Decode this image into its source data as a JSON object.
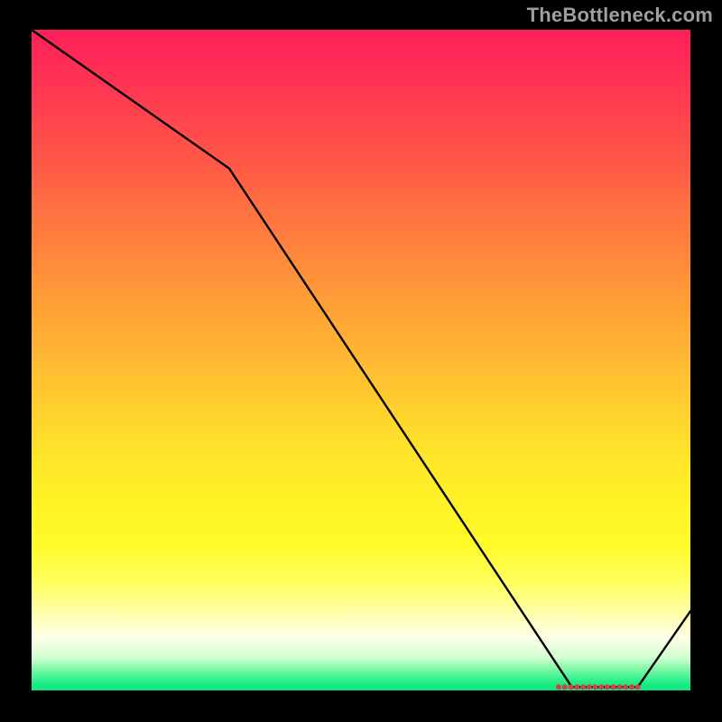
{
  "attribution": "TheBottleneck.com",
  "chart_data": {
    "type": "line",
    "title": "",
    "xlabel": "",
    "ylabel": "",
    "xlim": [
      0,
      100
    ],
    "ylim": [
      0,
      100
    ],
    "grid": false,
    "x": [
      0,
      30,
      82,
      92,
      100
    ],
    "values": [
      100,
      79,
      0.5,
      0.5,
      12
    ],
    "markers": {
      "x_range": [
        80,
        92
      ],
      "y": 0.5,
      "count": 14,
      "color": "#cc4444"
    },
    "line_color": "#000000",
    "background": {
      "gradient_top": "#ff1f59",
      "gradient_bottom": "#18ec84"
    }
  }
}
